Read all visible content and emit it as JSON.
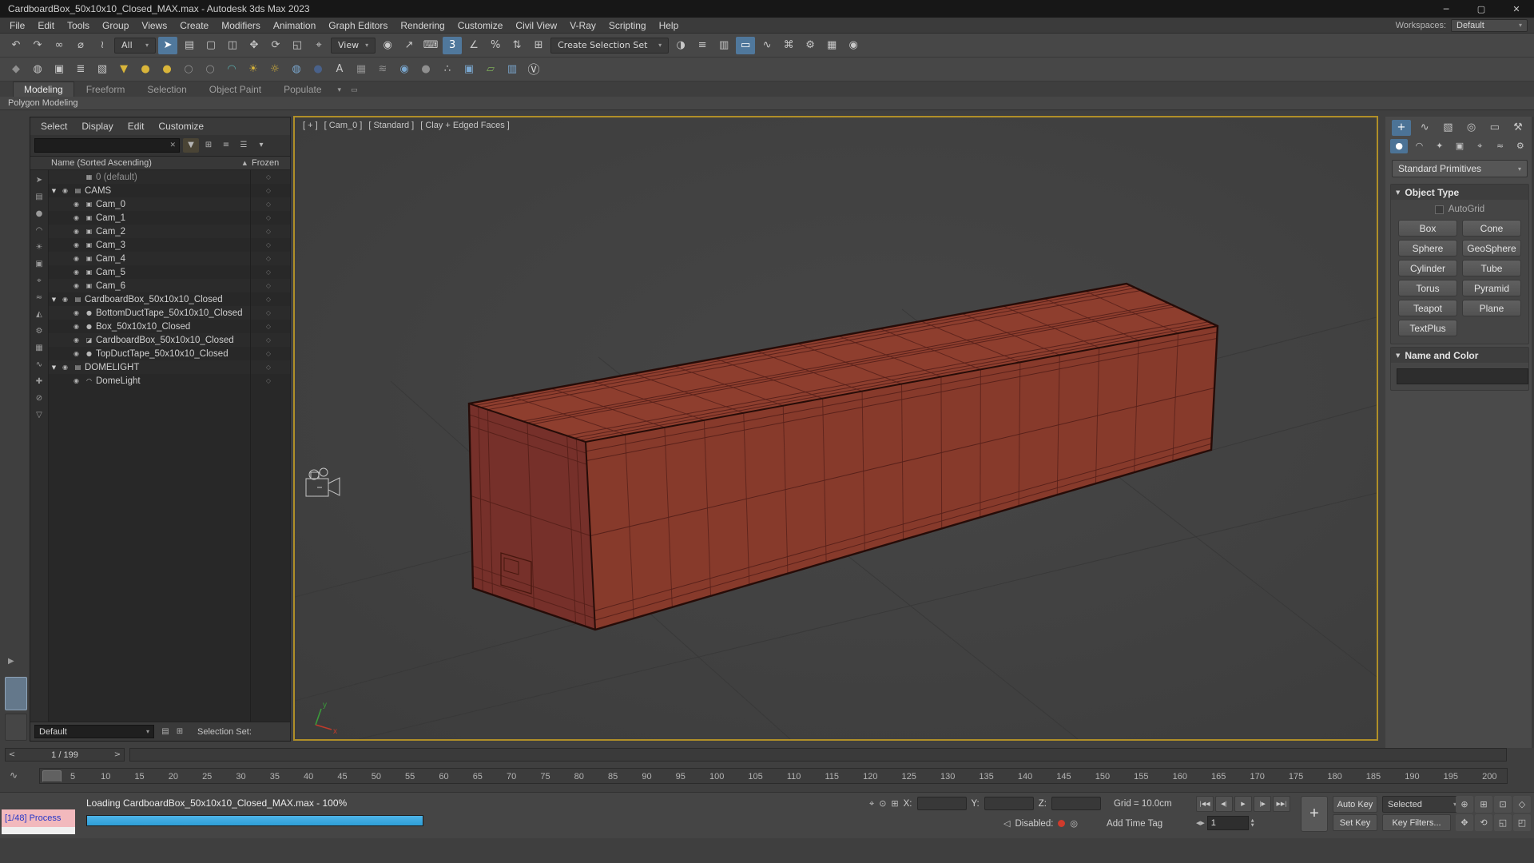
{
  "window": {
    "title": "CardboardBox_50x10x10_Closed_MAX.max - Autodesk 3ds Max 2023",
    "minimize": "─",
    "maximize": "▢",
    "close": "✕"
  },
  "menubar": {
    "items": [
      "File",
      "Edit",
      "Tools",
      "Group",
      "Views",
      "Create",
      "Modifiers",
      "Animation",
      "Graph Editors",
      "Rendering",
      "Customize",
      "Civil View",
      "V-Ray",
      "Scripting",
      "Help"
    ],
    "workspaces_label": "Workspaces:",
    "workspaces_value": "Default"
  },
  "toolbar_main": {
    "items": [
      {
        "g": "↶",
        "n": "undo-icon"
      },
      {
        "g": "↷",
        "n": "redo-icon"
      },
      {
        "g": "∞",
        "n": "select-and-link-icon"
      },
      {
        "g": "⌀",
        "n": "unlink-selection-icon"
      },
      {
        "g": "≀",
        "n": "bind-to-space-warp-icon"
      },
      {
        "g": "All",
        "n": "selection-filter-dropdown",
        "cls": "dd"
      },
      {
        "g": "➤",
        "n": "select-object-icon",
        "cls": "active"
      },
      {
        "g": "▤",
        "n": "select-by-name-icon"
      },
      {
        "g": "▢",
        "n": "selection-region-icon"
      },
      {
        "g": "◫",
        "n": "window-crossing-icon"
      },
      {
        "g": "✥",
        "n": "select-and-move-icon"
      },
      {
        "g": "⟳",
        "n": "select-and-rotate-icon"
      },
      {
        "g": "◱",
        "n": "select-and-scale-icon"
      },
      {
        "g": "⌖",
        "n": "select-and-place-icon"
      },
      {
        "g": "View",
        "n": "reference-coordinate-dropdown",
        "cls": "dd"
      },
      {
        "g": "◉",
        "n": "use-center-icon"
      },
      {
        "g": "↗",
        "n": "select-and-manipulate-icon"
      },
      {
        "g": "⌨",
        "n": "keyboard-override-icon"
      },
      {
        "g": "3",
        "n": "snaps-toggle-icon",
        "cls": "active"
      },
      {
        "g": "∠",
        "n": "angle-snap-icon"
      },
      {
        "g": "%",
        "n": "percent-snap-icon"
      },
      {
        "g": "⇅",
        "n": "spinner-snap-icon"
      },
      {
        "g": "⊞",
        "n": "named-selection-sets-icon"
      },
      {
        "g": "Create Selection Set",
        "n": "create-selection-set-dropdown",
        "cls": "dd wide"
      },
      {
        "g": "◑",
        "n": "mirror-icon"
      },
      {
        "g": "≡",
        "n": "align-icon"
      },
      {
        "g": "▥",
        "n": "layer-explorer-icon"
      },
      {
        "g": "▭",
        "n": "toggle-ribbon-icon",
        "cls": "active"
      },
      {
        "g": "∿",
        "n": "curve-editor-icon"
      },
      {
        "g": "⌘",
        "n": "schematic-view-icon"
      },
      {
        "g": "⚙",
        "n": "render-setup-icon"
      },
      {
        "g": "▦",
        "n": "rendered-frame-window-icon"
      },
      {
        "g": "◉",
        "n": "render-production-icon"
      }
    ]
  },
  "toolbar_secondary": {
    "items": [
      {
        "g": "◆",
        "n": "render-presets-icon",
        "cls": "dim"
      },
      {
        "g": "◍",
        "n": "environment-icon"
      },
      {
        "g": "▣",
        "n": "render-frame-icon"
      },
      {
        "g": "≣",
        "n": "batch-render-icon"
      },
      {
        "g": "▧",
        "n": "state-sets-icon"
      },
      {
        "g": "▼",
        "n": "light-lister-icon",
        "cls": "yellow"
      },
      {
        "g": "●",
        "n": "vray-sphere-light-icon",
        "cls": "yellow"
      },
      {
        "g": "●",
        "n": "omni-light-icon",
        "cls": "yellow"
      },
      {
        "g": "○",
        "n": "light-dim-icon",
        "cls": "dim"
      },
      {
        "g": "○",
        "n": "light-dim2-icon",
        "cls": "dim"
      },
      {
        "g": "◠",
        "n": "dome-light-icon",
        "cls": "teal"
      },
      {
        "g": "☀",
        "n": "sun-light-icon",
        "cls": "yellow"
      },
      {
        "g": "☼",
        "n": "sky-light-icon",
        "cls": "yellow"
      },
      {
        "g": "◍",
        "n": "hdri-sphere-icon",
        "cls": "blue"
      },
      {
        "g": "●",
        "n": "dark-sphere-icon",
        "cls": "navy"
      },
      {
        "g": "A",
        "n": "text-tool-icon"
      },
      {
        "g": "▦",
        "n": "grid-helper-icon",
        "cls": "dim"
      },
      {
        "g": "≋",
        "n": "noise-tool-icon",
        "cls": "dim"
      },
      {
        "g": "◉",
        "n": "globe-tool-icon",
        "cls": "blue"
      },
      {
        "g": "●",
        "n": "gray-sphere-icon",
        "cls": "dim"
      },
      {
        "g": "∴",
        "n": "particles-icon"
      },
      {
        "g": "▣",
        "n": "physical-camera-icon",
        "cls": "blue"
      },
      {
        "g": "▱",
        "n": "proxy-tool-icon",
        "cls": "green"
      },
      {
        "g": "▥",
        "n": "container-tool-icon",
        "cls": "blue"
      },
      {
        "g": "Ⓥ",
        "n": "vray-menu-icon",
        "cls": "vray"
      }
    ]
  },
  "ribbon": {
    "tabs": [
      {
        "label": "Modeling",
        "cls": "active"
      },
      {
        "label": "Freeform"
      },
      {
        "label": "Selection"
      },
      {
        "label": "Object Paint"
      },
      {
        "label": "Populate"
      }
    ],
    "collapse_icon": "▾",
    "panel_icon": "▭",
    "strip_label": "Polygon Modeling"
  },
  "explorer": {
    "menus": [
      "Select",
      "Display",
      "Edit",
      "Customize"
    ],
    "clear_icon": "✕",
    "top_icons": [
      {
        "g": "▼",
        "n": "filter-icon",
        "cls": "yellow"
      },
      {
        "g": "⊞",
        "n": "pick-filter-icon"
      },
      {
        "g": "≡",
        "n": "lock-explorer-icon"
      },
      {
        "g": "☰",
        "n": "column-chooser-icon"
      },
      {
        "g": "▾",
        "n": "explorer-options-icon"
      }
    ],
    "column_name": "Name (Sorted Ascending)",
    "sort_arrow": "▲",
    "column_frozen": "Frozen",
    "frozen_glyph": "◇",
    "side_icons": [
      {
        "g": "➤"
      },
      {
        "g": "▤"
      },
      {
        "g": "●",
        "cls": "blue"
      },
      {
        "g": "◠"
      },
      {
        "g": "☀",
        "cls": "yellow"
      },
      {
        "g": "▣"
      },
      {
        "g": "⌖"
      },
      {
        "g": "≈"
      },
      {
        "g": "◭",
        "cls": "green"
      },
      {
        "g": "⚙"
      },
      {
        "g": "▦"
      },
      {
        "g": "∿"
      },
      {
        "g": "✚"
      },
      {
        "g": "⊘"
      },
      {
        "g": "▽"
      }
    ],
    "rows": [
      {
        "name": "0 (default)",
        "cls": "lvl1 dim",
        "tri": "",
        "eye": "",
        "icon": "▦"
      },
      {
        "name": "CAMS",
        "cls": "lvl0",
        "tri": "▼",
        "eye": "◉",
        "icon": "▤"
      },
      {
        "name": "Cam_0",
        "cls": "lvl1",
        "tri": "",
        "eye": "◉",
        "icon": "▣"
      },
      {
        "name": "Cam_1",
        "cls": "lvl1",
        "tri": "",
        "eye": "◉",
        "icon": "▣"
      },
      {
        "name": "Cam_2",
        "cls": "lvl1",
        "tri": "",
        "eye": "◉",
        "icon": "▣"
      },
      {
        "name": "Cam_3",
        "cls": "lvl1",
        "tri": "",
        "eye": "◉",
        "icon": "▣"
      },
      {
        "name": "Cam_4",
        "cls": "lvl1",
        "tri": "",
        "eye": "◉",
        "icon": "▣"
      },
      {
        "name": "Cam_5",
        "cls": "lvl1",
        "tri": "",
        "eye": "◉",
        "icon": "▣"
      },
      {
        "name": "Cam_6",
        "cls": "lvl1",
        "tri": "",
        "eye": "◉",
        "icon": "▣"
      },
      {
        "name": "CardboardBox_50x10x10_Closed",
        "cls": "lvl0",
        "tri": "▼",
        "eye": "◉",
        "icon": "▤",
        "iconcls": "green"
      },
      {
        "name": "BottomDuctTape_50x10x10_Closed",
        "cls": "lvl1",
        "tri": "",
        "eye": "◉",
        "icon": "●"
      },
      {
        "name": "Box_50x10x10_Closed",
        "cls": "lvl1",
        "tri": "",
        "eye": "◉",
        "icon": "●"
      },
      {
        "name": "CardboardBox_50x10x10_Closed",
        "cls": "lvl1",
        "tri": "",
        "eye": "◉",
        "icon": "◪",
        "iconcls": "red"
      },
      {
        "name": "TopDuctTape_50x10x10_Closed",
        "cls": "lvl1",
        "tri": "",
        "eye": "◉",
        "icon": "●"
      },
      {
        "name": "DOMELIGHT",
        "cls": "lvl0",
        "tri": "▼",
        "eye": "◉",
        "icon": "▤"
      },
      {
        "name": "DomeLight",
        "cls": "lvl1",
        "tri": "",
        "eye": "◉",
        "icon": "◠",
        "iconcls": "yellow"
      }
    ],
    "footer": {
      "dropdown_value": "Default",
      "icons": [
        {
          "g": "▤",
          "n": "named-sets-icon"
        },
        {
          "g": "⊞",
          "n": "edit-sets-icon"
        }
      ],
      "selection_set_label": "Selection Set:"
    }
  },
  "gutter": {
    "expand_icon": "▶"
  },
  "viewport": {
    "label_parts": [
      "[ + ]",
      "[ Cam_0 ]",
      "[ Standard ]",
      "[ Clay + Edged Faces ]"
    ]
  },
  "command_panel": {
    "tabs": [
      {
        "g": "+",
        "n": "create-tab-icon",
        "cls": "active"
      },
      {
        "g": "∿",
        "n": "modify-tab-icon"
      },
      {
        "g": "▧",
        "n": "hierarchy-tab-icon"
      },
      {
        "g": "◎",
        "n": "motion-tab-icon"
      },
      {
        "g": "▭",
        "n": "display-tab-icon"
      },
      {
        "g": "⚒",
        "n": "utilities-tab-icon"
      }
    ],
    "categories": [
      {
        "g": "●",
        "n": "geometry-category-icon",
        "cls": "active"
      },
      {
        "g": "◠",
        "n": "shapes-category-icon"
      },
      {
        "g": "✦",
        "n": "lights-category-icon"
      },
      {
        "g": "▣",
        "n": "cameras-category-icon"
      },
      {
        "g": "⌖",
        "n": "helpers-category-icon"
      },
      {
        "g": "≈",
        "n": "space-warps-category-icon"
      },
      {
        "g": "⚙",
        "n": "systems-category-icon"
      }
    ],
    "dropdown_value": "Standard Primitives",
    "rollout_arrow": "▼",
    "rollout_object_type": "Object Type",
    "autogrid_label": "AutoGrid",
    "buttons": [
      "Box",
      "Cone",
      "Sphere",
      "GeoSphere",
      "Cylinder",
      "Tube",
      "Torus",
      "Pyramid",
      "Teapot",
      "Plane",
      "TextPlus"
    ],
    "rollout_name_color": "Name and Color",
    "name_value": "",
    "color_swatch": "#e0218a"
  },
  "trackbar": {
    "prev": "<",
    "frame_indicator": "1 / 199",
    "next": ">"
  },
  "timeline": {
    "curve_icon": "∿",
    "ticks": [
      5,
      10,
      15,
      20,
      25,
      30,
      35,
      40,
      45,
      50,
      55,
      60,
      65,
      70,
      75,
      80,
      85,
      90,
      95,
      100,
      105,
      110,
      115,
      120,
      125,
      130,
      135,
      140,
      145,
      150,
      155,
      160,
      165,
      170,
      175,
      180,
      185,
      190,
      195,
      200
    ]
  },
  "statusbar": {
    "process_label": "[1/48] Process",
    "loading_text": "Loading CardboardBox_50x10x10_Closed_MAX.max - 100%",
    "progress_pct": 100,
    "isolate_icon": "⌖",
    "lock_icon": "⊙",
    "grid_icon": "⊞",
    "x_label": "X:",
    "y_label": "Y:",
    "z_label": "Z:",
    "grid_label": "Grid = 10.0cm",
    "mute_icon": "◁",
    "disabled_label": "Disabled:",
    "circle_icon": "◎",
    "add_time_tag": "Add Time Tag",
    "playback": [
      {
        "g": "|◀◀",
        "n": "go-to-start-button"
      },
      {
        "g": "◀|",
        "n": "previous-frame-button"
      },
      {
        "g": "▶",
        "n": "play-button"
      },
      {
        "g": "|▶",
        "n": "next-frame-button"
      },
      {
        "g": "▶▶|",
        "n": "go-to-end-button"
      }
    ],
    "key_plus": "+",
    "auto_key": "Auto Key",
    "set_key": "Set Key",
    "selected_dropdown": "Selected",
    "key_filters": "Key Filters...",
    "spin_left": "◀",
    "spin_right": "▶",
    "spin_up": "▲",
    "spin_down": "▼",
    "time_value": "1",
    "nav_icons": [
      {
        "g": "⊕",
        "n": "zoom-icon"
      },
      {
        "g": "⊞",
        "n": "zoom-all-icon"
      },
      {
        "g": "⊡",
        "n": "zoom-extents-icon"
      },
      {
        "g": "◇",
        "n": "field-of-view-icon"
      },
      {
        "g": "✥",
        "n": "pan-icon"
      },
      {
        "g": "⟲",
        "n": "orbit-icon"
      },
      {
        "g": "◱",
        "n": "zoom-region-icon"
      },
      {
        "g": "◰",
        "n": "maximize-viewport-icon"
      }
    ]
  }
}
